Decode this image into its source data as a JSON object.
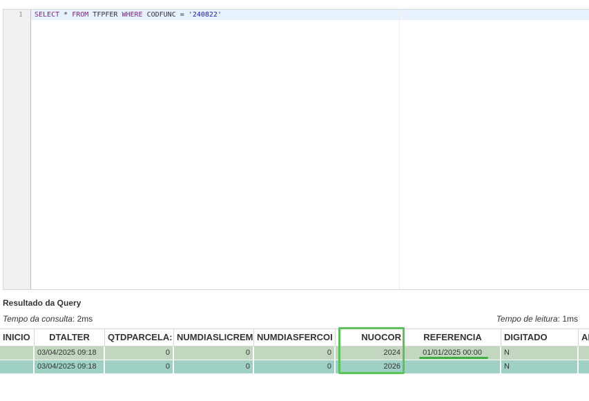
{
  "editor": {
    "line_number": "1",
    "sql": {
      "kw_select": "SELECT",
      "star": " * ",
      "kw_from": "FROM",
      "table": " TFPFER ",
      "kw_where": "WHERE",
      "condition": " CODFUNC = ",
      "value": "'240822'"
    }
  },
  "results": {
    "title": "Resultado da Query",
    "query_time_label": "Tempo da consulta",
    "query_time_value": ": 2ms",
    "read_time_label": "Tempo de leitura",
    "read_time_value": ": 1ms",
    "columns": [
      "INICIO",
      "DTALTER",
      "QTDPARCELA:",
      "NUMDIASLICREM",
      "NUMDIASFERCOI",
      "NUOCOR",
      "REFERENCIA",
      "DIGITADO",
      "AI"
    ],
    "rows": [
      [
        "",
        "03/04/2025 09:18",
        "0",
        "0",
        "0",
        "2024",
        "01/01/2025 00:00",
        "N",
        ""
      ],
      [
        "",
        "03/04/2025 09:18",
        "0",
        "0",
        "0",
        "2026",
        "",
        "N",
        ""
      ]
    ]
  },
  "colors": {
    "row1": "#c3d6bf",
    "row2": "#9fd0c4",
    "highlight": "#5ac35a"
  }
}
